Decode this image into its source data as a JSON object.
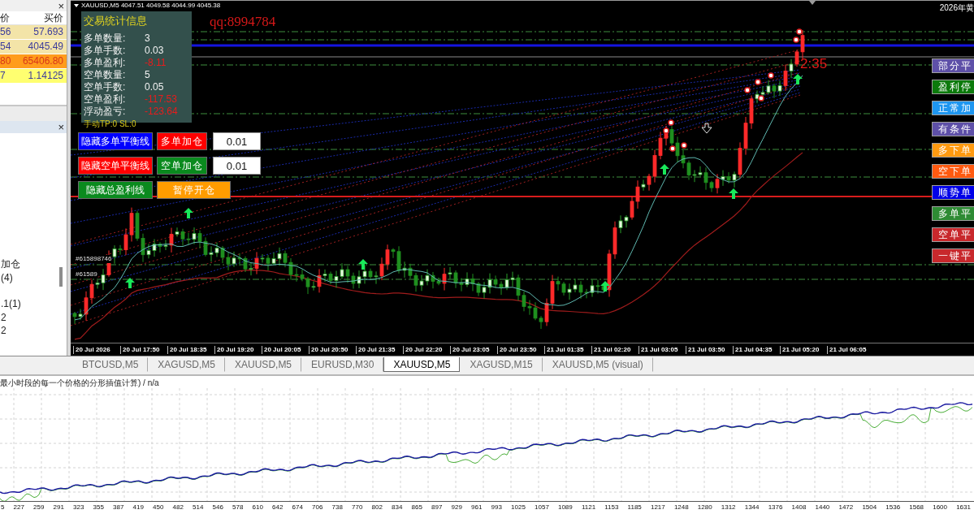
{
  "market_watch": {
    "close_label": "×",
    "columns": [
      "价",
      "买价"
    ],
    "rows": [
      {
        "cells": [
          "56",
          "57.693"
        ],
        "color": "#f3e4a8",
        "kind": "normal"
      },
      {
        "cells": [
          "54",
          "4045.49"
        ],
        "color": "#f3e4a8",
        "kind": "normal"
      },
      {
        "cells": [
          "80",
          "65406.80"
        ],
        "color": "#ff9c1c",
        "kind": "alert"
      },
      {
        "cells": [
          "7",
          "1.14125"
        ],
        "color": "#ffff70",
        "kind": "normal"
      }
    ]
  },
  "navigator": {
    "close_label": "×",
    "items": [
      "加仓",
      "(4)",
      ".1(1)",
      "2",
      "2"
    ]
  },
  "chart": {
    "title": "XAUUSD,M5  4047.51 4049.58 4044.99 4045.38",
    "corner_text": "2026年黄",
    "account_label": "qq:8994784",
    "countdown": "2:35",
    "order_labels": [
      "#615898746",
      "#61589"
    ],
    "x_labels": [
      "20 Jul 2026",
      "20 Jul 17:50",
      "20 Jul 18:35",
      "20 Jul 19:20",
      "20 Jul 20:05",
      "20 Jul 20:50",
      "20 Jul 21:35",
      "20 Jul 22:20",
      "20 Jul 23:05",
      "20 Jul 23:50",
      "21 Jul 01:35",
      "21 Jul 02:20",
      "21 Jul 03:05",
      "21 Jul 03:50",
      "21 Jul 04:35",
      "21 Jul 05:20",
      "21 Jul 06:05"
    ]
  },
  "stats_panel": {
    "title": "交易统计信息",
    "rows": [
      {
        "label": "多单数量:",
        "value": "3",
        "kind": "count"
      },
      {
        "label": "多单手数:",
        "value": "0.03",
        "kind": "count"
      },
      {
        "label": "多单盈利:",
        "value": "-8.11",
        "kind": "loss"
      },
      {
        "label": "空单数量:",
        "value": "5",
        "kind": "count"
      },
      {
        "label": "空单手数:",
        "value": "0.05",
        "kind": "count"
      },
      {
        "label": "空单盈利:",
        "value": "-117.53",
        "kind": "loss"
      },
      {
        "label": "浮动盈亏:",
        "value": "-123.64",
        "kind": "loss"
      }
    ]
  },
  "manual_tp_sl": "手动TP:0 SL:0",
  "control_rows": [
    [
      {
        "kind": "button",
        "label": "隐藏多单平衡线",
        "color": "#0000ff"
      },
      {
        "kind": "button",
        "label": "多单加仓",
        "color": "#ff0000"
      },
      {
        "kind": "input",
        "value": "0.01"
      }
    ],
    [
      {
        "kind": "button",
        "label": "隐藏空单平衡线",
        "color": "#ff0000"
      },
      {
        "kind": "button",
        "label": "空单加仓",
        "color": "#0a8a1e"
      },
      {
        "kind": "input",
        "value": "0.01"
      }
    ],
    [
      {
        "kind": "button",
        "label": "隐藏总盈利线",
        "color": "#0a8a1e"
      },
      {
        "kind": "button",
        "label": "暂停开仓",
        "color": "#ff9c00"
      }
    ]
  ],
  "side_buttons": [
    {
      "label": "部分平",
      "color": "#5e50a8"
    },
    {
      "label": "盈利停",
      "color": "#0c7a0c"
    },
    {
      "label": "正常加",
      "color": "#1e96f0"
    },
    {
      "label": "有条件",
      "color": "#5e50a8"
    },
    {
      "label": "多下单",
      "color": "#ff9a10"
    },
    {
      "label": "空下单",
      "color": "#ff5a10"
    },
    {
      "label": "顺势单",
      "color": "#0000e8"
    },
    {
      "label": "多单平",
      "color": "#2e8b34"
    },
    {
      "label": "空单平",
      "color": "#c8282c"
    },
    {
      "label": "一键平",
      "color": "#c8282c"
    }
  ],
  "tabs": [
    {
      "label": "BTCUSD,M5",
      "selected": false
    },
    {
      "label": "XAGUSD,M5",
      "selected": false
    },
    {
      "label": "XAUUSD,M5",
      "selected": false
    },
    {
      "label": "EURUSD,M30",
      "selected": false
    },
    {
      "label": "XAUUSD,M5",
      "selected": true
    },
    {
      "label": "XAGUSD,M15",
      "selected": false
    },
    {
      "label": "XAUUSD,M5 (visual)",
      "selected": false
    }
  ],
  "tester_graph": {
    "caption": "最小时段的每一个价格的分形插值计算) / n/a",
    "x_labels": [
      "5",
      "227",
      "259",
      "291",
      "323",
      "355",
      "387",
      "419",
      "450",
      "482",
      "514",
      "546",
      "578",
      "610",
      "642",
      "674",
      "706",
      "738",
      "770",
      "802",
      "834",
      "865",
      "897",
      "929",
      "961",
      "993",
      "1025",
      "1057",
      "1089",
      "1121",
      "1153",
      "1185",
      "1217",
      "1248",
      "1280",
      "1312",
      "1344",
      "1376",
      "1408",
      "1440",
      "1472",
      "1504",
      "1536",
      "1568",
      "1600",
      "1631"
    ]
  }
}
